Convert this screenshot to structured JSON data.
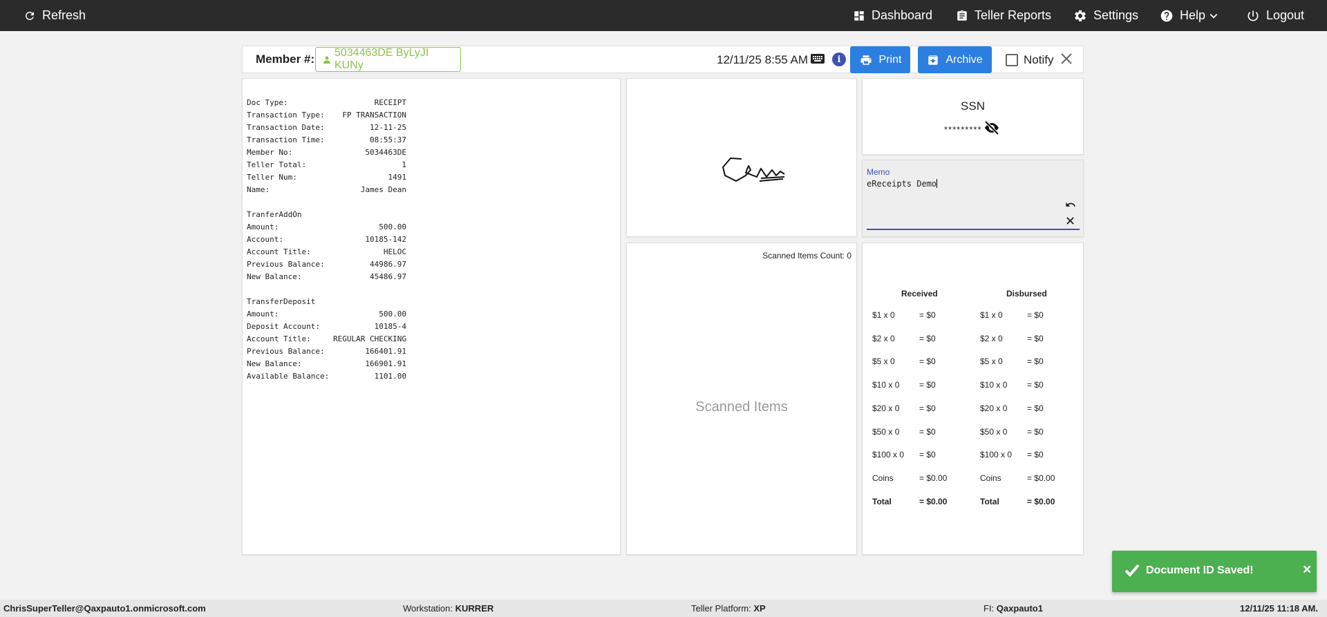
{
  "nav": {
    "refresh": "Refresh",
    "dashboard": "Dashboard",
    "teller_reports": "Teller Reports",
    "settings": "Settings",
    "help": "Help",
    "logout": "Logout"
  },
  "header": {
    "member_label": "Member #:",
    "member_value": "5034463DE ByLyJI KUNy",
    "datetime": "12/11/25 8:55 AM",
    "print": "Print",
    "archive": "Archive",
    "notify": "Notify"
  },
  "receipt": {
    "rows": [
      {
        "k": "Doc Type:",
        "v": "RECEIPT"
      },
      {
        "k": "Transaction Type:",
        "v": "FP TRANSACTION"
      },
      {
        "k": "Transaction Date:",
        "v": "12-11-25"
      },
      {
        "k": "Transaction Time:",
        "v": "08:55:37"
      },
      {
        "k": "Member No:",
        "v": "5034463DE"
      },
      {
        "k": "Teller Total:",
        "v": "1"
      },
      {
        "k": "Teller Num:",
        "v": "1491"
      },
      {
        "k": "Name:",
        "v": "James Dean"
      },
      {
        "gap": true
      },
      {
        "k": "TranferAddOn",
        "v": ""
      },
      {
        "k": "Amount:",
        "v": "500.00"
      },
      {
        "k": "Account:",
        "v": "10185-142"
      },
      {
        "k": "Account Title:",
        "v": "HELOC"
      },
      {
        "k": "Previous Balance:",
        "v": "44986.97"
      },
      {
        "k": "New Balance:",
        "v": "45486.97"
      },
      {
        "gap": true
      },
      {
        "k": "TransferDeposit",
        "v": ""
      },
      {
        "k": "Amount:",
        "v": "500.00"
      },
      {
        "k": "Deposit Account:",
        "v": "10185-4"
      },
      {
        "k": "Account Title:",
        "v": "REGULAR CHECKING"
      },
      {
        "k": "Previous Balance:",
        "v": "166401.91"
      },
      {
        "k": "New Balance:",
        "v": "166901.91"
      },
      {
        "k": "Available Balance:",
        "v": "1101.00"
      }
    ]
  },
  "ssn": {
    "title": "SSN",
    "masked": "*********"
  },
  "memo": {
    "label": "Memo",
    "value": "eReceipts Demo"
  },
  "scanned": {
    "count_text": "Scanned Items Count: 0",
    "placeholder": "Scanned Items"
  },
  "cash": {
    "received_header": "Received",
    "disbursed_header": "Disbursed",
    "rows": [
      {
        "r_label": "$1 x 0",
        "r_val": "= $0",
        "d_label": "$1 x 0",
        "d_val": "= $0"
      },
      {
        "r_label": "$2 x 0",
        "r_val": "= $0",
        "d_label": "$2 x 0",
        "d_val": "= $0"
      },
      {
        "r_label": "$5 x 0",
        "r_val": "= $0",
        "d_label": "$5 x 0",
        "d_val": "= $0"
      },
      {
        "r_label": "$10 x 0",
        "r_val": "= $0",
        "d_label": "$10 x 0",
        "d_val": "= $0"
      },
      {
        "r_label": "$20 x 0",
        "r_val": "= $0",
        "d_label": "$20 x 0",
        "d_val": "= $0"
      },
      {
        "r_label": "$50 x 0",
        "r_val": "= $0",
        "d_label": "$50 x 0",
        "d_val": "= $0"
      },
      {
        "r_label": "$100 x 0",
        "r_val": "= $0",
        "d_label": "$100 x 0",
        "d_val": "= $0"
      },
      {
        "r_label": "Coins",
        "r_val": "= $0.00",
        "d_label": "Coins",
        "d_val": "= $0.00"
      },
      {
        "r_label": "Total",
        "r_val": "= $0.00",
        "d_label": "Total",
        "d_val": "= $0.00",
        "bold": true
      }
    ]
  },
  "toast": {
    "message": "Document ID Saved!"
  },
  "status": {
    "user": "ChrisSuperTeller@Qaxpauto1.onmicrosoft.com",
    "workstation_label": "Workstation:",
    "workstation": "KURRER",
    "platform_label": "Teller Platform:",
    "platform": "XP",
    "fi_label": "FI:",
    "fi": "Qaxpauto1",
    "datetime": "12/11/25 11:18 AM."
  },
  "colors": {
    "navbar": "#2b2b2b",
    "primary_button": "#2c7fe0",
    "member_chip": "#8bc34a",
    "memo_accent": "#3f51b5",
    "toast": "#4caf50"
  }
}
